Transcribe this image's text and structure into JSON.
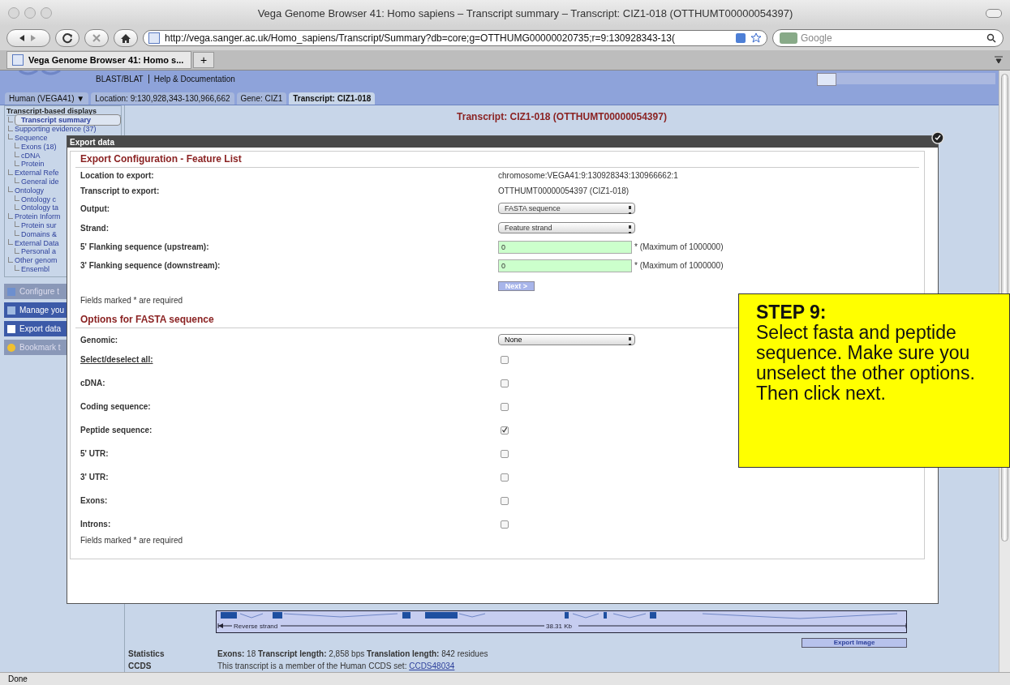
{
  "browser": {
    "title": "Vega Genome Browser 41: Homo sapiens – Transcript summary – Transcript: CIZ1-018 (OTTHUMT00000054397)",
    "url": "http://vega.sanger.ac.uk/Homo_sapiens/Transcript/Summary?db=core;g=OTTHUMG00000020735;r=9:130928343-13(",
    "search_placeholder": "Google",
    "tab": "Vega Genome Browser 41: Homo s...",
    "new_tab": "+",
    "status": "Done"
  },
  "site": {
    "links": [
      "BLAST/BLAT",
      "Help & Documentation"
    ],
    "breadcrumbs": [
      {
        "label": "Human (VEGA41) ▼",
        "selected": false
      },
      {
        "label": "Location: 9:130,928,343-130,966,662",
        "selected": false
      },
      {
        "label": "Gene: CIZ1",
        "selected": false
      },
      {
        "label": "Transcript: CIZ1-018",
        "selected": true
      }
    ],
    "page_title": "Transcript: CIZ1-018 (OTTHUMT00000054397)"
  },
  "sidebar": {
    "heading": "Transcript-based displays",
    "items": [
      {
        "label": "Transcript summary",
        "selected": true
      },
      {
        "label": "Supporting evidence (37)",
        "selected": false
      },
      {
        "label": "Sequence",
        "selected": false,
        "children": [
          {
            "label": "Exons (18)",
            "selected": false
          },
          {
            "label": "cDNA",
            "selected": false
          },
          {
            "label": "Protein",
            "selected": false
          }
        ]
      },
      {
        "label": "External Refe",
        "selected": false,
        "children": [
          {
            "label": "General ide",
            "selected": false
          }
        ]
      },
      {
        "label": "Ontology",
        "selected": false,
        "children": [
          {
            "label": "Ontology c",
            "selected": false
          },
          {
            "label": "Ontology ta",
            "selected": false
          }
        ]
      },
      {
        "label": "Protein Inform",
        "selected": false,
        "children": [
          {
            "label": "Protein sur",
            "selected": false
          },
          {
            "label": "Domains &",
            "selected": false
          }
        ]
      },
      {
        "label": "External Data",
        "selected": false,
        "children": [
          {
            "label": "Personal a",
            "selected": false
          }
        ]
      },
      {
        "label": "Other genom",
        "selected": false,
        "children": [
          {
            "label": "Ensembl",
            "selected": false
          }
        ]
      }
    ],
    "buttons": [
      {
        "label": "Configure t",
        "disabled": true,
        "kind": "wrench"
      },
      {
        "label": "Manage you",
        "disabled": false,
        "kind": "files"
      },
      {
        "label": "Export data",
        "disabled": false,
        "kind": "page"
      },
      {
        "label": "Bookmark t",
        "disabled": true,
        "kind": "star"
      }
    ]
  },
  "modal": {
    "title": "Export data",
    "config": {
      "heading": "Export Configuration - Feature List",
      "rows": [
        {
          "kind": "text",
          "label": "Location to export:",
          "value": "chromosome:VEGA41:9:130928343:130966662:1"
        },
        {
          "kind": "text",
          "label": "Transcript to export:",
          "value": "OTTHUMT00000054397 (CIZ1-018)"
        },
        {
          "kind": "select",
          "label": "Output:",
          "value": "FASTA sequence"
        },
        {
          "kind": "select",
          "label": "Strand:",
          "value": "Feature strand"
        },
        {
          "kind": "input",
          "label": "5' Flanking sequence (upstream):",
          "value": "0",
          "note": "* (Maximum of 1000000)"
        },
        {
          "kind": "input",
          "label": "3' Flanking sequence (downstream):",
          "value": "0",
          "note": "* (Maximum of 1000000)"
        }
      ],
      "next_button": "Next >",
      "required_note": "Fields marked * are required"
    },
    "options": {
      "heading": "Options for FASTA sequence",
      "rows": [
        {
          "kind": "select",
          "label": "Genomic:",
          "value": "None"
        },
        {
          "kind": "toggle_all",
          "label": "Select/deselect all:",
          "checked": false
        },
        {
          "kind": "checkbox",
          "label": "cDNA:",
          "checked": false
        },
        {
          "kind": "checkbox",
          "label": "Coding sequence:",
          "checked": false
        },
        {
          "kind": "checkbox",
          "label": "Peptide sequence:",
          "checked": true
        },
        {
          "kind": "checkbox",
          "label": "5' UTR:",
          "checked": false
        },
        {
          "kind": "checkbox",
          "label": "3' UTR:",
          "checked": false
        },
        {
          "kind": "checkbox",
          "label": "Exons:",
          "checked": false
        },
        {
          "kind": "checkbox",
          "label": "Introns:",
          "checked": false
        }
      ],
      "required_note": "Fields marked * are required"
    }
  },
  "track": {
    "strand_label": "Reverse strand",
    "length_label": "38.31 Kb",
    "export_button": "Export Image"
  },
  "summary": [
    {
      "label": "Statistics",
      "value": "**Exons:** 18 **Transcript length:** 2,858 bps **Translation length:** 842 residues"
    },
    {
      "label": "CCDS",
      "value": "This transcript is a member of the Human CCDS set:",
      "link": "CCDS48034"
    }
  ],
  "callout": {
    "title": "STEP 9:",
    "text": "Select fasta and peptide sequence. Make sure you unselect the other options. Then click next."
  }
}
